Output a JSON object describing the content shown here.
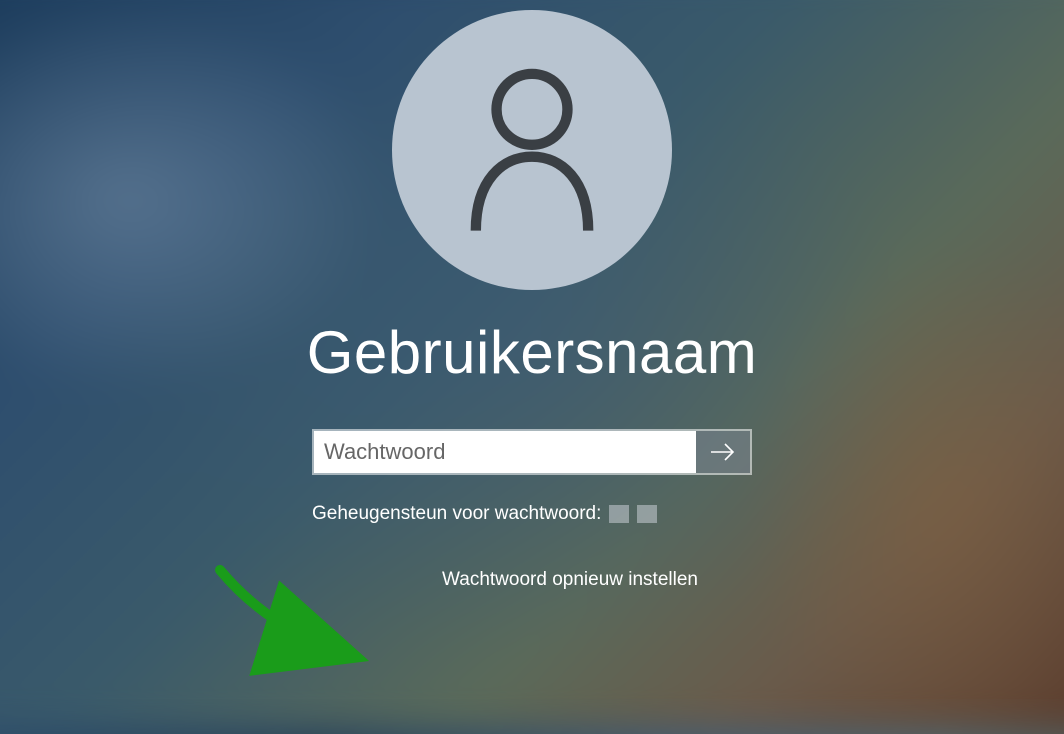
{
  "login": {
    "username": "Gebruikersnaam",
    "password_placeholder": "Wachtwoord",
    "password_value": "",
    "hint_label": "Geheugensteun voor wachtwoord:",
    "reset_link": "Wachtwoord opnieuw instellen"
  }
}
